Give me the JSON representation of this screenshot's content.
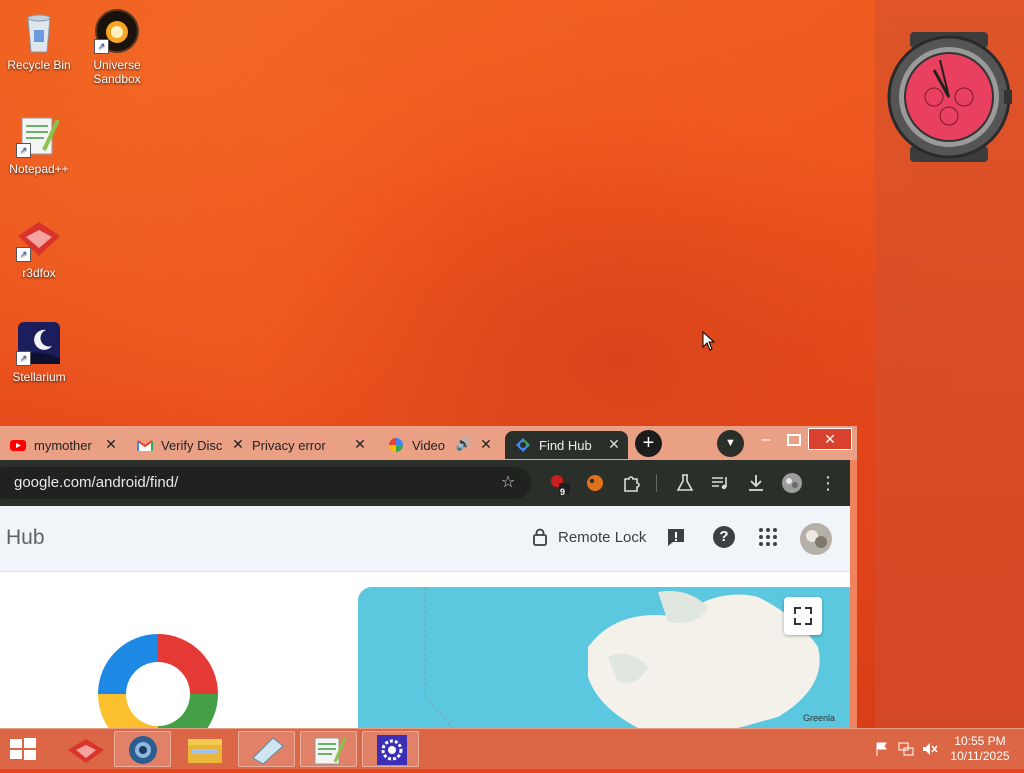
{
  "desktop": {
    "icons": [
      {
        "label": "Recycle Bin"
      },
      {
        "label": "Universe Sandbox"
      },
      {
        "label": "Notepad++"
      },
      {
        "label": "r3dfox"
      },
      {
        "label": "Stellarium"
      }
    ]
  },
  "browser": {
    "tabs": [
      {
        "title": "mymother",
        "icon": "youtube-icon"
      },
      {
        "title": "Verify Disc",
        "icon": "gmail-icon"
      },
      {
        "title": "Privacy error",
        "icon": "warning-icon"
      },
      {
        "title": "Video",
        "icon": "pinwheel-icon"
      },
      {
        "title": "Find Hub",
        "icon": "find-hub-icon",
        "active": true
      }
    ],
    "url": "google.com/android/find/",
    "extension_badge": "9",
    "page": {
      "title": "Hub",
      "remote_lock_label": "Remote Lock",
      "map_label": "Greenla"
    }
  },
  "taskbar": {
    "time": "10:55 PM",
    "date": "10/11/2025"
  },
  "colors": {
    "accent": "#e8461a",
    "browser_frame": "#2b2f2a",
    "map_water": "#5cc8df"
  }
}
